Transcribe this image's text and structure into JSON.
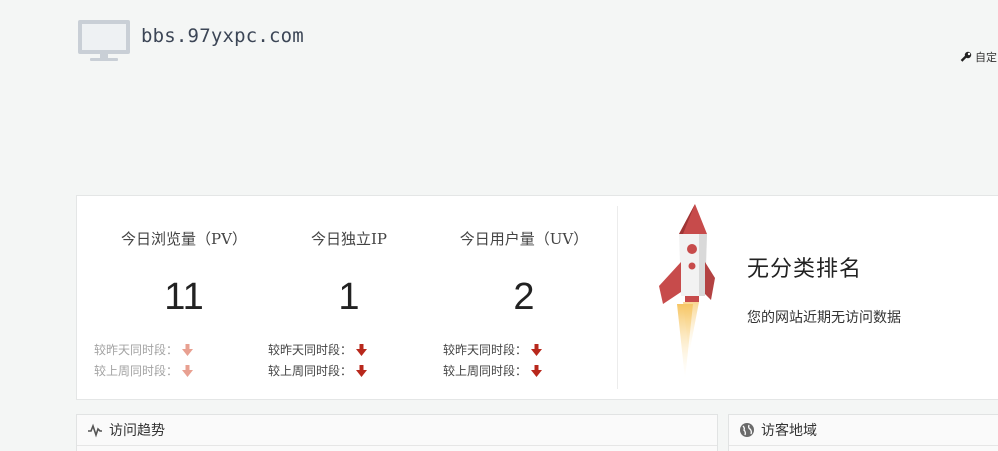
{
  "header": {
    "domain": "bbs.97yxpc.com",
    "customize_label": "自定"
  },
  "stats": [
    {
      "label": "今日浏览量（PV）",
      "value": "11",
      "compare_yesterday": "较昨天同时段：",
      "compare_lastweek": "较上周同时段："
    },
    {
      "label": "今日独立IP",
      "value": "1",
      "compare_yesterday": "较昨天同时段：",
      "compare_lastweek": "较上周同时段："
    },
    {
      "label": "今日用户量（UV）",
      "value": "2",
      "compare_yesterday": "较昨天同时段：",
      "compare_lastweek": "较上周同时段："
    }
  ],
  "ranking": {
    "title": "无分类排名",
    "description": "您的网站近期无访问数据"
  },
  "panels": {
    "trend_title": "访问趋势",
    "region_title": "访客地域"
  },
  "colors": {
    "arrow_down": "#c0392b",
    "arrow_down_muted": "#e8a091",
    "rocket_red": "#c74b4b",
    "flame": "#f6c563"
  }
}
